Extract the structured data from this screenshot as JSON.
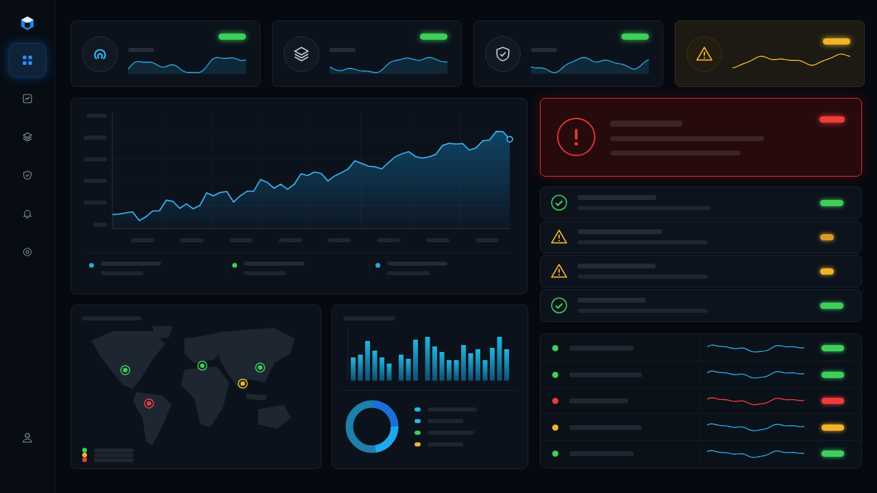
{
  "sidebar": {
    "items": [
      {
        "kind": "dashboard",
        "selected": true
      },
      {
        "kind": "analytics",
        "selected": false
      },
      {
        "kind": "layers",
        "selected": false
      },
      {
        "kind": "security",
        "selected": false
      },
      {
        "kind": "alerts",
        "selected": false
      },
      {
        "kind": "settings",
        "selected": false
      }
    ]
  },
  "stat_cards": [
    {
      "kind": "gauge",
      "color": "#3ecf5a"
    },
    {
      "kind": "layers",
      "color": "#3ecf5a"
    },
    {
      "kind": "shield",
      "color": "#3ecf5a"
    },
    {
      "kind": "warning",
      "color": "#f0b429"
    }
  ],
  "trend": {
    "legend": [
      {
        "color": "#2aa7e0"
      },
      {
        "color": "#3ecf5a"
      },
      {
        "color": "#36a3e8"
      }
    ]
  },
  "map": {
    "markers": [
      {
        "color": "#3ecf5a"
      },
      {
        "color": "#3ecf5a"
      },
      {
        "color": "#3ecf5a"
      },
      {
        "color": "#f0b429"
      },
      {
        "color": "#ef3b3b"
      }
    ],
    "legend": [
      {
        "color": "#3ecf5a"
      },
      {
        "color": "#f0b429"
      },
      {
        "color": "#ef3b3b"
      }
    ]
  },
  "breakdown": {
    "legend": [
      {
        "color": "#27b4ec"
      },
      {
        "color": "#27b4ec"
      },
      {
        "color": "#3ecf5a"
      },
      {
        "color": "#f0b429"
      }
    ]
  },
  "alert": {
    "kind": "critical"
  },
  "checks": [
    {
      "kind": "ok",
      "color": "#3ecf5a"
    },
    {
      "kind": "warning",
      "color": "#d99a2b"
    },
    {
      "kind": "warning",
      "color": "#f0b429"
    },
    {
      "kind": "ok",
      "color": "#3ecf5a"
    }
  ],
  "services": [
    {
      "kind": "normal",
      "color": "#3ecf5a"
    },
    {
      "kind": "normal",
      "color": "#3ecf5a"
    },
    {
      "kind": "critical",
      "color": "#ef3b3b"
    },
    {
      "kind": "normal",
      "color": "#f0b429"
    },
    {
      "kind": "normal",
      "color": "#3ecf5a"
    }
  ]
}
